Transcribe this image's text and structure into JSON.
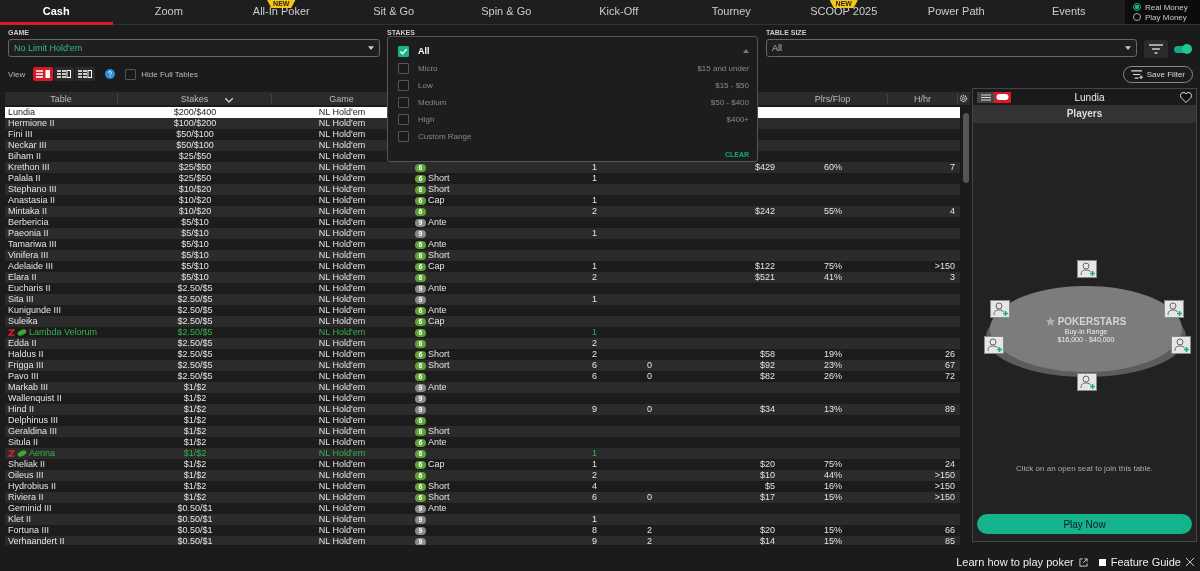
{
  "tabs": [
    {
      "label": "Cash",
      "selected": true
    },
    {
      "label": "Zoom",
      "selected": false
    },
    {
      "label": "All-In Poker",
      "selected": false,
      "badge": "NEW"
    },
    {
      "label": "Sit & Go",
      "selected": false
    },
    {
      "label": "Spin & Go",
      "selected": false
    },
    {
      "label": "Kick-Off",
      "selected": false
    },
    {
      "label": "Tourney",
      "selected": false
    },
    {
      "label": "SCOOP 2025",
      "selected": false,
      "badge": "NEW"
    },
    {
      "label": "Power Path",
      "selected": false
    },
    {
      "label": "Events",
      "selected": false
    }
  ],
  "money_mode": [
    {
      "label": "Real Money",
      "selected": true
    },
    {
      "label": "Play Money",
      "selected": false
    }
  ],
  "filters": {
    "game": {
      "label": "GAME",
      "value": "No Limit Hold'em"
    },
    "stakes": {
      "label": "STAKES",
      "clear": "CLEAR",
      "options": [
        {
          "label": "All",
          "checked": true
        },
        {
          "label": "Micro",
          "range": "$15 and under",
          "checked": false
        },
        {
          "label": "Low",
          "range": "$15 - $50",
          "checked": false
        },
        {
          "label": "Medium",
          "range": "$50 - $400",
          "checked": false
        },
        {
          "label": "High",
          "range": "$400+",
          "checked": false
        },
        {
          "label": "Custom Range",
          "checked": false
        }
      ]
    },
    "table_size": {
      "label": "TABLE SIZE",
      "value": "All"
    },
    "quick_filter_on": true
  },
  "view": {
    "label": "View",
    "modes": [
      {
        "selected": true
      },
      {
        "selected": false
      },
      {
        "selected": false
      }
    ],
    "hide_full": {
      "label": "Hide Full Tables",
      "checked": false
    },
    "save_filter": "Save Filter"
  },
  "table": {
    "columns": [
      {
        "label": "Table",
        "sorted": false
      },
      {
        "label": "Stakes",
        "sorted": true
      },
      {
        "label": "Game",
        "sorted": false
      },
      {
        "label": "Plrs/Flop",
        "sorted": false
      },
      {
        "label": "H/hr",
        "sorted": false
      }
    ],
    "rows": [
      {
        "name": "Lundia",
        "stakes": "$200/$400",
        "game": "NL Hold'em",
        "kind": "standard",
        "selected": true
      },
      {
        "name": "Hermione II",
        "stakes": "$100/$200",
        "game": "NL Hold'em",
        "kind": "standard",
        "selected": false
      },
      {
        "name": "Fini III",
        "stakes": "$50/$100",
        "game": "NL Hold'em",
        "kind": "standard",
        "selected": false
      },
      {
        "name": "Neckar III",
        "stakes": "$50/$100",
        "game": "NL Hold'em",
        "kind": "standard",
        "selected": false
      },
      {
        "name": "Biham II",
        "stakes": "$25/$50",
        "game": "NL Hold'em",
        "kind": "standard",
        "selected": false
      },
      {
        "name": "Krethon III",
        "stakes": "$25/$50",
        "game": "NL Hold'em",
        "seats": "6",
        "color": "#5ea336",
        "players": "1",
        "avg_pot": "$429",
        "plrs_flop": "60%",
        "hands_hr": "7",
        "kind": "standard",
        "selected": false
      },
      {
        "name": "Palala II",
        "stakes": "$25/$50",
        "game": "NL Hold'em",
        "seats": "6",
        "color": "#5ea336",
        "type": "Short",
        "players": "1",
        "kind": "standard",
        "selected": false
      },
      {
        "name": "Stephano III",
        "stakes": "$10/$20",
        "game": "NL Hold'em",
        "seats": "6",
        "color": "#5ea336",
        "type": "Short",
        "kind": "standard",
        "selected": false
      },
      {
        "name": "Anastasia II",
        "stakes": "$10/$20",
        "game": "NL Hold'em",
        "seats": "6",
        "color": "#5ea336",
        "type": "Cap",
        "players": "1",
        "kind": "standard",
        "selected": false
      },
      {
        "name": "Mintaka II",
        "stakes": "$10/$20",
        "game": "NL Hold'em",
        "seats": "6",
        "color": "#5ea336",
        "players": "2",
        "avg_pot": "$242",
        "plrs_flop": "55%",
        "hands_hr": "4",
        "kind": "standard",
        "selected": false
      },
      {
        "name": "Berbericia",
        "stakes": "$5/$10",
        "game": "NL Hold'em",
        "seats": "9",
        "color": "#8a8a8a",
        "type": "Ante",
        "kind": "standard",
        "selected": false
      },
      {
        "name": "Paeonia II",
        "stakes": "$5/$10",
        "game": "NL Hold'em",
        "seats": "9",
        "color": "#8a8a8a",
        "players": "1",
        "kind": "standard",
        "selected": false
      },
      {
        "name": "Tamariwa III",
        "stakes": "$5/$10",
        "game": "NL Hold'em",
        "seats": "6",
        "color": "#5ea336",
        "type": "Ante",
        "kind": "standard",
        "selected": false
      },
      {
        "name": "Vinifera III",
        "stakes": "$5/$10",
        "game": "NL Hold'em",
        "seats": "6",
        "color": "#5ea336",
        "type": "Short",
        "kind": "standard",
        "selected": false
      },
      {
        "name": "Adelaide III",
        "stakes": "$5/$10",
        "game": "NL Hold'em",
        "seats": "6",
        "color": "#5ea336",
        "type": "Cap",
        "players": "1",
        "avg_pot": "$122",
        "plrs_flop": "75%",
        "hands_hr": ">150",
        "kind": "standard",
        "selected": false
      },
      {
        "name": "Elara II",
        "stakes": "$5/$10",
        "game": "NL Hold'em",
        "seats": "6",
        "color": "#5ea336",
        "players": "2",
        "avg_pot": "$521",
        "plrs_flop": "41%",
        "hands_hr": "3",
        "kind": "standard",
        "selected": false
      },
      {
        "name": "Eucharis II",
        "stakes": "$2.50/$5",
        "game": "NL Hold'em",
        "seats": "9",
        "color": "#8a8a8a",
        "type": "Ante",
        "kind": "standard",
        "selected": false
      },
      {
        "name": "Sita III",
        "stakes": "$2.50/$5",
        "game": "NL Hold'em",
        "seats": "9",
        "color": "#8a8a8a",
        "players": "1",
        "kind": "standard",
        "selected": false
      },
      {
        "name": "Kunigunde III",
        "stakes": "$2.50/$5",
        "game": "NL Hold'em",
        "seats": "6",
        "color": "#5ea336",
        "type": "Ante",
        "kind": "standard",
        "selected": false
      },
      {
        "name": "Suleika",
        "stakes": "$2.50/$5",
        "game": "NL Hold'em",
        "seats": "6",
        "color": "#5ea336",
        "type": "Cap",
        "kind": "standard",
        "selected": false
      },
      {
        "name": "Lambda Velorum",
        "stakes": "$2.50/$5",
        "game": "NL Hold'em",
        "seats": "6",
        "color": "#5ea336",
        "players": "1",
        "kind": "featured",
        "selected": false
      },
      {
        "name": "Edda II",
        "stakes": "$2.50/$5",
        "game": "NL Hold'em",
        "seats": "6",
        "color": "#5ea336",
        "players": "2",
        "kind": "standard",
        "selected": false
      },
      {
        "name": "Haldus II",
        "stakes": "$2.50/$5",
        "game": "NL Hold'em",
        "seats": "6",
        "color": "#5ea336",
        "type": "Short",
        "players": "2",
        "avg_pot": "$58",
        "plrs_flop": "19%",
        "hands_hr": "26",
        "kind": "standard",
        "selected": false
      },
      {
        "name": "Frigga III",
        "stakes": "$2.50/$5",
        "game": "NL Hold'em",
        "seats": "6",
        "color": "#5ea336",
        "type": "Short",
        "players": "6",
        "waiting": "0",
        "avg_pot": "$92",
        "plrs_flop": "23%",
        "hands_hr": "67",
        "kind": "standard",
        "selected": false
      },
      {
        "name": "Pavo III",
        "stakes": "$2.50/$5",
        "game": "NL Hold'em",
        "seats": "6",
        "color": "#5ea336",
        "players": "6",
        "waiting": "0",
        "avg_pot": "$82",
        "plrs_flop": "26%",
        "hands_hr": "72",
        "kind": "standard",
        "selected": false
      },
      {
        "name": "Markab III",
        "stakes": "$1/$2",
        "game": "NL Hold'em",
        "seats": "9",
        "color": "#8a8a8a",
        "type": "Ante",
        "kind": "standard",
        "selected": false
      },
      {
        "name": "Wallenquist II",
        "stakes": "$1/$2",
        "game": "NL Hold'em",
        "seats": "9",
        "color": "#8a8a8a",
        "kind": "standard",
        "selected": false
      },
      {
        "name": "Hind II",
        "stakes": "$1/$2",
        "game": "NL Hold'em",
        "seats": "9",
        "color": "#8a8a8a",
        "players": "9",
        "waiting": "0",
        "avg_pot": "$34",
        "plrs_flop": "13%",
        "hands_hr": "89",
        "kind": "standard",
        "selected": false
      },
      {
        "name": "Delphinus III",
        "stakes": "$1/$2",
        "game": "NL Hold'em",
        "seats": "6",
        "color": "#5ea336",
        "kind": "standard",
        "selected": false
      },
      {
        "name": "Geraldina III",
        "stakes": "$1/$2",
        "game": "NL Hold'em",
        "seats": "6",
        "color": "#5ea336",
        "type": "Short",
        "kind": "standard",
        "selected": false
      },
      {
        "name": "Situla II",
        "stakes": "$1/$2",
        "game": "NL Hold'em",
        "seats": "6",
        "color": "#5ea336",
        "type": "Ante",
        "kind": "standard",
        "selected": false
      },
      {
        "name": "Aenna",
        "stakes": "$1/$2",
        "game": "NL Hold'em",
        "seats": "6",
        "color": "#5ea336",
        "players": "1",
        "kind": "featured",
        "selected": false
      },
      {
        "name": "Sheliak II",
        "stakes": "$1/$2",
        "game": "NL Hold'em",
        "seats": "6",
        "color": "#5ea336",
        "type": "Cap",
        "players": "1",
        "avg_pot": "$20",
        "plrs_flop": "75%",
        "hands_hr": "24",
        "kind": "standard",
        "selected": false
      },
      {
        "name": "Oileus III",
        "stakes": "$1/$2",
        "game": "NL Hold'em",
        "seats": "6",
        "color": "#5ea336",
        "players": "2",
        "avg_pot": "$10",
        "plrs_flop": "44%",
        "hands_hr": ">150",
        "kind": "standard",
        "selected": false
      },
      {
        "name": "Hydrobius II",
        "stakes": "$1/$2",
        "game": "NL Hold'em",
        "seats": "6",
        "color": "#5ea336",
        "type": "Short",
        "players": "4",
        "avg_pot": "$5",
        "plrs_flop": "16%",
        "hands_hr": ">150",
        "kind": "standard",
        "selected": false
      },
      {
        "name": "Riviera II",
        "stakes": "$1/$2",
        "game": "NL Hold'em",
        "seats": "6",
        "color": "#5ea336",
        "type": "Short",
        "players": "6",
        "waiting": "0",
        "avg_pot": "$17",
        "plrs_flop": "15%",
        "hands_hr": ">150",
        "kind": "standard",
        "selected": false
      },
      {
        "name": "Geminid III",
        "stakes": "$0.50/$1",
        "game": "NL Hold'em",
        "seats": "9",
        "color": "#8a8a8a",
        "type": "Ante",
        "kind": "standard",
        "selected": false
      },
      {
        "name": "Klet II",
        "stakes": "$0.50/$1",
        "game": "NL Hold'em",
        "seats": "9",
        "color": "#8a8a8a",
        "players": "1",
        "kind": "standard",
        "selected": false
      },
      {
        "name": "Fortuna III",
        "stakes": "$0.50/$1",
        "game": "NL Hold'em",
        "seats": "9",
        "color": "#8a8a8a",
        "players": "8",
        "waiting": "2",
        "avg_pot": "$20",
        "plrs_flop": "15%",
        "hands_hr": "66",
        "kind": "standard",
        "selected": false
      },
      {
        "name": "Verhaandert II",
        "stakes": "$0.50/$1",
        "game": "NL Hold'em",
        "seats": "9",
        "color": "#8a8a8a",
        "players": "9",
        "waiting": "2",
        "avg_pot": "$14",
        "plrs_flop": "15%",
        "hands_hr": "85",
        "kind": "standard",
        "selected": false
      }
    ]
  },
  "panel": {
    "views": [
      {
        "selected": false
      },
      {
        "selected": true
      }
    ],
    "title": "Lundia",
    "section": "Players",
    "logo": "POKERSTARS",
    "buy_in_label": "Buy-in Range",
    "buy_in": "$16,000 - $40,000",
    "hint": "Click on an open seat to join this table.",
    "play_now": "Play Now"
  },
  "footer": {
    "learn": "Learn how to play poker",
    "feature_guide": "Feature Guide"
  }
}
